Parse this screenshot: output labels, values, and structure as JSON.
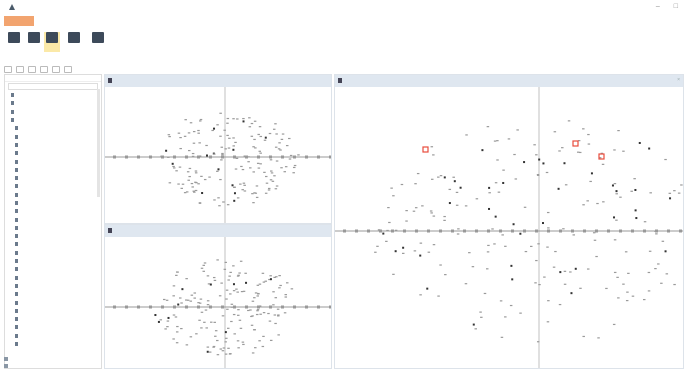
{
  "window": {
    "title": "",
    "minimize": "–",
    "maximize": "□",
    "user": ""
  },
  "menu": {
    "file_tab": "",
    "items": [
      "",
      "",
      ""
    ]
  },
  "ribbon": {
    "buttons": [
      {
        "label": "",
        "icon": "view-icon"
      },
      {
        "label": "",
        "icon": "layout-icon"
      },
      {
        "label": "",
        "icon": "split-icon",
        "active": true
      },
      {
        "label": "",
        "icon": "grid-icon"
      },
      {
        "label": "",
        "icon": "tool-icon"
      }
    ],
    "group_label": ""
  },
  "sidebar": {
    "header": "",
    "items": [
      "",
      "",
      "",
      "",
      "",
      "",
      "",
      "",
      "",
      "",
      "",
      "",
      "",
      "",
      "",
      "",
      "",
      "",
      "",
      "",
      "",
      "",
      "",
      "",
      "",
      "",
      "",
      "",
      "",
      "",
      ""
    ]
  },
  "panels": {
    "top_left": {
      "title": "",
      "subtitle": ""
    },
    "bottom_left": {
      "title": "",
      "subtitle": ""
    },
    "right": {
      "title": "",
      "subtitle": ""
    }
  },
  "statusbar": {
    "items": [
      "",
      ""
    ]
  },
  "colors": {
    "file_tab": "#f2a46f",
    "highlight": "#fbe9a8",
    "panel_header": "#dfe7f0",
    "marker_red": "#e84c3d",
    "dot_gray": "#9a9a9a",
    "dot_dark": "#333333"
  }
}
